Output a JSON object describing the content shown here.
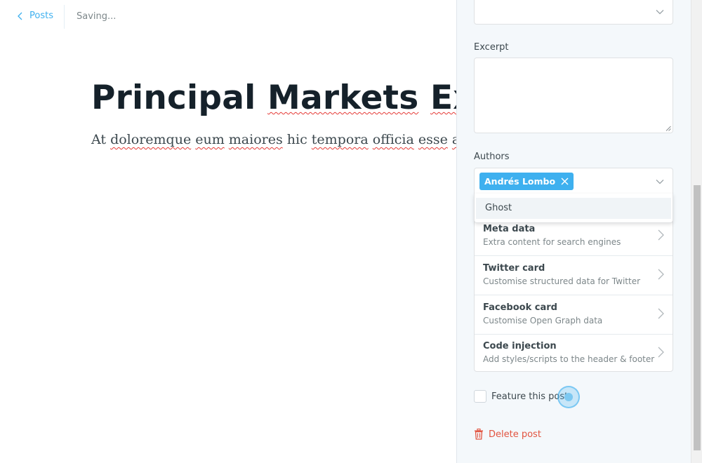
{
  "topbar": {
    "back_label": "Posts",
    "status": "Saving..."
  },
  "post": {
    "title": "Principal Markets Executive",
    "body_words": [
      "At",
      "doloremque",
      "eum",
      "maiores",
      "hic",
      "tempora",
      "officia",
      "esse",
      "animi"
    ]
  },
  "settings": {
    "excerpt_label": "Excerpt",
    "excerpt_value": "",
    "authors_label": "Authors",
    "author_chip": "Andrés Lombo",
    "dropdown_option": "Ghost",
    "menu": [
      {
        "title": "Meta data",
        "description": "Extra content for search engines"
      },
      {
        "title": "Twitter card",
        "description": "Customise structured data for Twitter"
      },
      {
        "title": "Facebook card",
        "description": "Customise Open Graph data"
      },
      {
        "title": "Code injection",
        "description": "Add styles/scripts to the header & footer"
      }
    ],
    "feature_label": "Feature this post",
    "feature_checked": false,
    "delete_label": "Delete post"
  },
  "colors": {
    "accent": "#3eb0ef",
    "danger": "#e25440",
    "panel_bg": "#f4f8fb",
    "title": "#15212a"
  },
  "icons": [
    "chevron-left-icon",
    "chevron-down-icon",
    "close-icon",
    "chevron-right-icon",
    "trash-icon",
    "resize-handle-icon"
  ]
}
